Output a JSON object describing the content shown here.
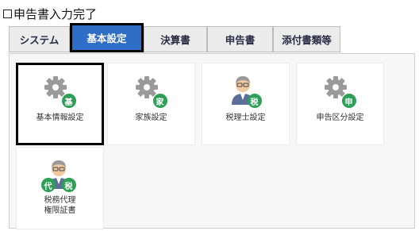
{
  "header": {
    "title": "申告書入力完了"
  },
  "tabs": [
    {
      "label": "システム"
    },
    {
      "label": "基本設定"
    },
    {
      "label": "決算書"
    },
    {
      "label": "申告書"
    },
    {
      "label": "添付書類等"
    }
  ],
  "tiles": [
    {
      "label": "基本情報設定",
      "icon": "gear-icon",
      "badge": "基"
    },
    {
      "label": "家族設定",
      "icon": "gear-icon",
      "badge": "家"
    },
    {
      "label": "税理士設定",
      "icon": "person-icon",
      "badge": "税"
    },
    {
      "label": "申告区分設定",
      "icon": "gear-icon",
      "badge": "申"
    },
    {
      "label_line1": "税務代理",
      "label_line2": "権限証書",
      "icon": "person-icon",
      "badge1": "代",
      "badge2": "税"
    }
  ],
  "colors": {
    "accent": "#2f6ec7",
    "badge": "#2e9f57",
    "gear": "#9a9a9a"
  }
}
